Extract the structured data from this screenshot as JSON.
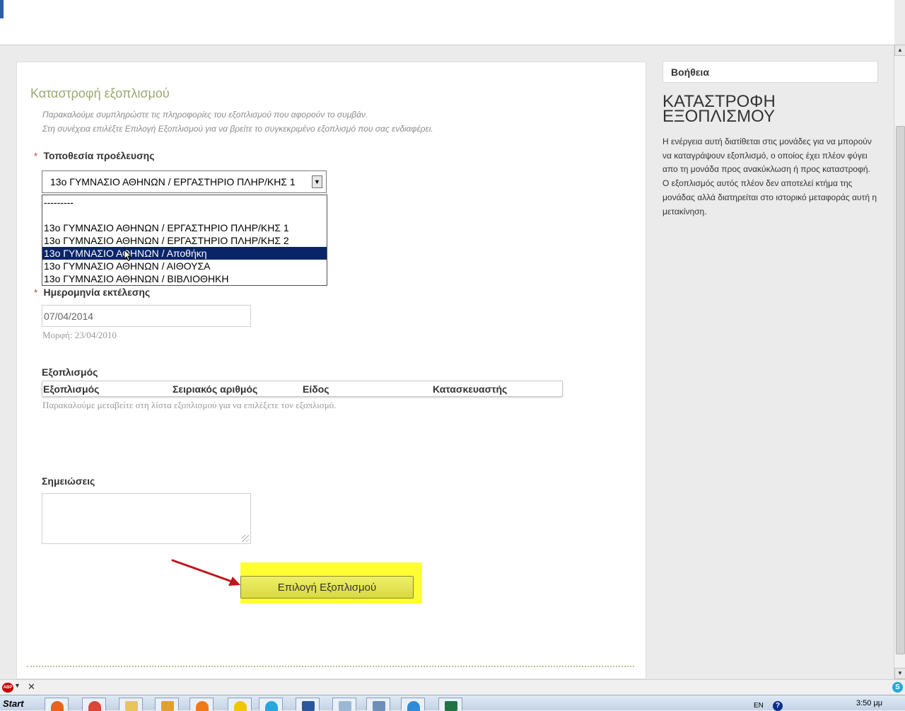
{
  "form": {
    "title": "Καταστροφή εξοπλισμού",
    "instructions": [
      "Παρακαλούμε συμπληρώστε τις πληροφορίες του εξοπλισμού που αφορούν το συμβάν.",
      "Στη συνέχεια επιλέξτε Επιλογή Εξοπλισμού για να βρείτε το συγκεκριμένο εξοπλισμό που σας ενδιαφέρει."
    ],
    "required_mark": "*",
    "origin_location": {
      "label": "Τοποθεσία προέλευσης",
      "selected_value": "13ο ΓΥΜΝΑΣΙΟ ΑΘΗΝΩΝ / ΕΡΓΑΣΤΗΡΙΟ ΠΛΗΡ/ΚΗΣ 1",
      "arrow": "▼",
      "options": [
        "---------",
        "",
        "13ο ΓΥΜΝΑΣΙΟ ΑΘΗΝΩΝ / ΕΡΓΑΣΤΗΡΙΟ ΠΛΗΡ/ΚΗΣ 1",
        "13ο ΓΥΜΝΑΣΙΟ ΑΘΗΝΩΝ / ΕΡΓΑΣΤΗΡΙΟ ΠΛΗΡ/ΚΗΣ 2",
        "13ο ΓΥΜΝΑΣΙΟ ΑΘΗΝΩΝ / Αποθήκη",
        "13ο ΓΥΜΝΑΣΙΟ ΑΘΗΝΩΝ / ΑΙΘΟΥΣΑ",
        "13ο ΓΥΜΝΑΣΙΟ ΑΘΗΝΩΝ / ΒΙΒΛΙΟΘΗΚΗ"
      ],
      "highlighted_option": "13ο ΓΥΜΝΑΣΙΟ ΑΘΗΝΩΝ / Αποθήκη"
    },
    "execution_date": {
      "label": "Ημερομηνία εκτέλεσης",
      "value": "07/04/2014",
      "hint": "Μορφή: 23/04/2010"
    },
    "equipment": {
      "label": "Εξοπλισμός",
      "columns": [
        "Εξοπλισμός",
        "Σειριακός αριθμός",
        "Είδος",
        "Κατασκευαστής"
      ],
      "hint": "Παρακαλούμε μεταβείτε στη λίστα εξοπλισμού για να επιλέξετε τον εξοπλισμό."
    },
    "notes": {
      "label": "Σημειώσεις",
      "value": ""
    },
    "select_button_label": "Επιλογή Εξοπλισμού"
  },
  "help": {
    "title": "Βοήθεια",
    "heading_line1": "ΚΑΤΑΣΤΡΟΦΗ",
    "heading_line2": "ΕΞΟΠΛΙΣΜΟΥ",
    "text": "Η ενέργεια αυτή διατίθεται στις μονάδες για να μπορούν να καταγράψουν εξοπλισμό, ο οποίος έχει πλέον φύγει απο τη μονάδα προς ανακύκλωση ή προς καταστροφή. Ο εξοπλισμός αυτός πλέον δεν αποτελεί κτήμα της μονάδας αλλά διατηρείται στο ιστορικό μεταφοράς αυτή η μετακίνηση."
  },
  "browser": {
    "close_glyph": "✕",
    "abp_label": "ABP",
    "skype_label": "S"
  },
  "taskbar": {
    "start_label": "Start",
    "language": "EN",
    "help_glyph": "?",
    "clock": "3:50 μμ"
  },
  "colors": {
    "title_green": "#9aa776",
    "highlight_yellow": "#ffff33",
    "selected_option_bg": "#0a246a",
    "arrow_red": "#c0141c"
  }
}
